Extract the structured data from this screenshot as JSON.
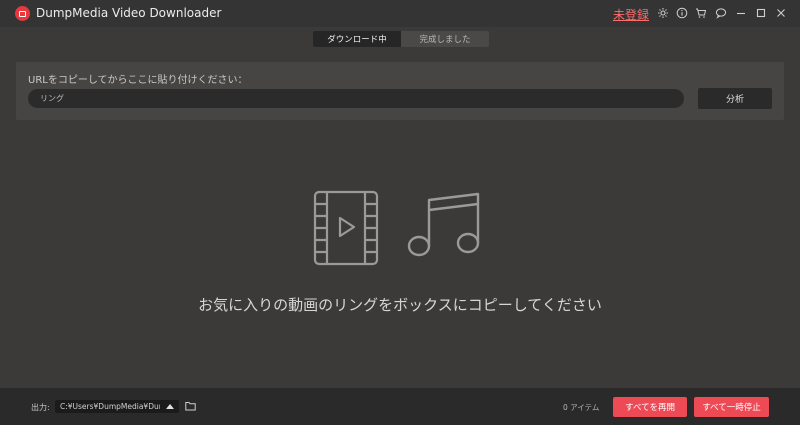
{
  "titlebar": {
    "app_title": "DumpMedia Video Downloader",
    "unregistered_label": "未登録",
    "icons": [
      "settings-icon",
      "info-icon",
      "cart-icon",
      "chat-icon",
      "minimize-icon",
      "maximize-icon",
      "close-icon"
    ]
  },
  "tabs": [
    {
      "label": "ダウンロード中",
      "active": true
    },
    {
      "label": "完成しました",
      "active": false
    }
  ],
  "url_panel": {
    "label": "URLをコピーしてからここに貼り付けください：",
    "input_value": "リング",
    "analyze_label": "分析"
  },
  "empty_state": {
    "message": "お気に入りの動画のリングをボックスにコピーしてください",
    "icons": [
      "film-play-icon",
      "music-note-icon"
    ]
  },
  "footer": {
    "output_label": "出力:",
    "output_path": "C:¥Users¥DumpMedia¥DumpMe",
    "item_count": "0 アイテム",
    "resume_all_label": "すべてを再開",
    "pause_all_label": "すべて一時停止"
  },
  "colors": {
    "accent": "#ee4a55",
    "background": "#3b3a39",
    "link": "#ff6d6a"
  }
}
